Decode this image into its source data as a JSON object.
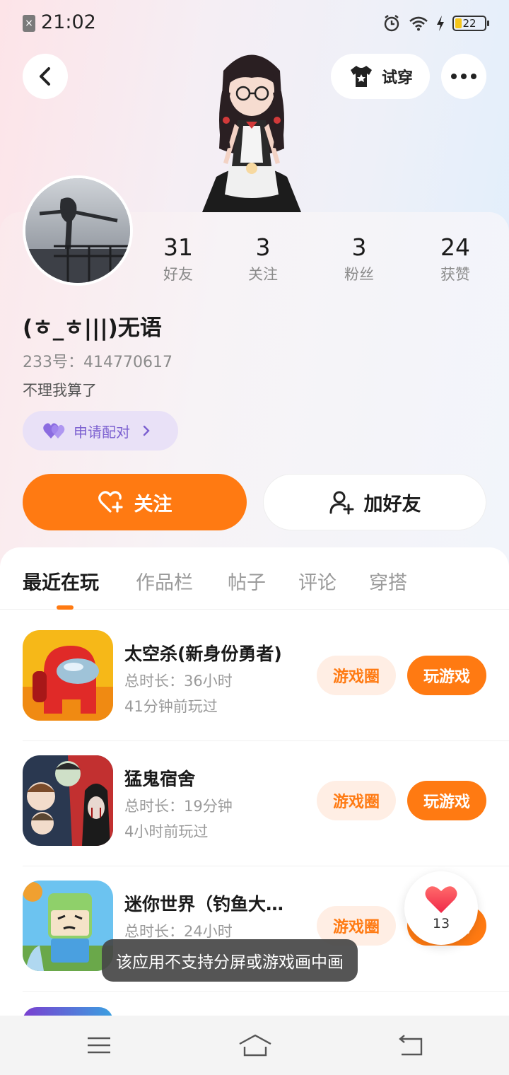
{
  "status_bar": {
    "time": "21:02",
    "battery": "22",
    "icons": [
      "sim-off-icon",
      "alarm-icon",
      "wifi-icon",
      "charging-icon",
      "battery-icon"
    ]
  },
  "top_nav": {
    "back_icon": "back-arrow-icon",
    "tryon_label": "试穿",
    "more_icon": "more-dots-icon"
  },
  "profile": {
    "stats": [
      {
        "value": "31",
        "label": "好友"
      },
      {
        "value": "3",
        "label": "关注"
      },
      {
        "value": "3",
        "label": "粉丝"
      },
      {
        "value": "24",
        "label": "获赞"
      }
    ],
    "username": "(ㅎ_ㅎ|||)无语",
    "uid_label": "233号：",
    "uid_value": "414770617",
    "bio": "不理我算了",
    "pair_label": "申请配对",
    "follow_label": "关注",
    "add_friend_label": "加好友"
  },
  "tabs": [
    {
      "label": "最近在玩",
      "active": true
    },
    {
      "label": "作品栏",
      "active": false
    },
    {
      "label": "帖子",
      "active": false
    },
    {
      "label": "评论",
      "active": false
    },
    {
      "label": "穿搭",
      "active": false
    }
  ],
  "games": [
    {
      "name": "太空杀(新身份勇者)",
      "duration": "总时长：36小时",
      "last_played": "41分钟前玩过",
      "circle_label": "游戏圈",
      "play_label": "玩游戏"
    },
    {
      "name": "猛鬼宿舍",
      "duration": "总时长：19分钟",
      "last_played": "4小时前玩过",
      "circle_label": "游戏圈",
      "play_label": "玩游戏"
    },
    {
      "name": "迷你世界（钓鱼大…",
      "duration": "总时长：24小时",
      "last_played": "",
      "circle_label": "游戏圈",
      "play_label": "玩游戏"
    }
  ],
  "like_float": {
    "count": "13"
  },
  "toast": {
    "text": "该应用不支持分屏或游戏画中画"
  },
  "colors": {
    "accent": "#ff7a12",
    "accent_light": "#ffeee4",
    "pair_bg": "#e9e1f7",
    "pair_text": "#7b5fd0"
  },
  "bottom_nav": {
    "icons": [
      "menu-icon",
      "home-icon",
      "back-icon"
    ]
  }
}
